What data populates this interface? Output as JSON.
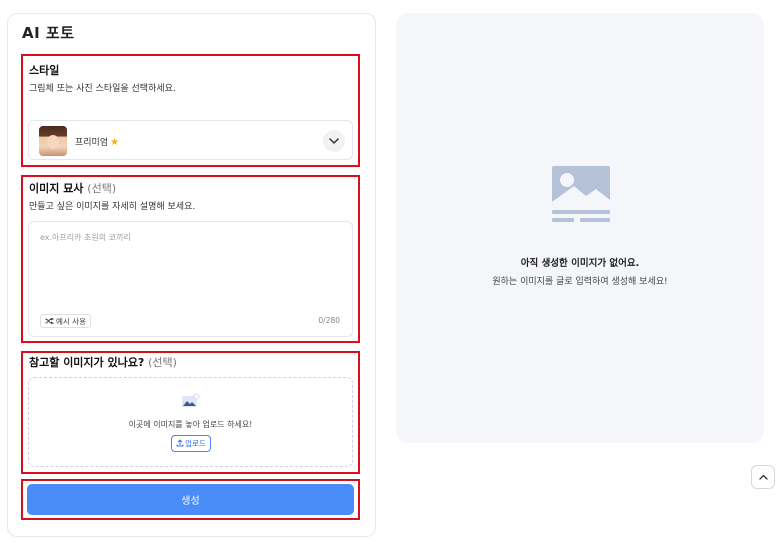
{
  "app": {
    "title": "AI 포토"
  },
  "style_section": {
    "title": "스타일",
    "description": "그림체 또는 사진 스타일을 선택하세요.",
    "selected_value": "프리미엄",
    "badge_icon": "star-icon",
    "dropdown_icon": "chevron-down-icon"
  },
  "description_section": {
    "title": "이미지 묘사",
    "optional": "(선택)",
    "description": "만들고 싶은 이미지를 자세히 설명해 보세요.",
    "placeholder": "ex.아프리카 초원의 코끼리",
    "example_button": "예시 사용",
    "example_icon": "shuffle-icon",
    "char_count": "0/280"
  },
  "reference_section": {
    "title": "참고할 이미지가 있나요?",
    "optional": "(선택)",
    "drop_text": "이곳에 이미지를 놓아 업로드 하세요!",
    "upload_button": "업로드",
    "upload_icon": "upload-icon"
  },
  "generate_button": "생성",
  "preview": {
    "empty_title": "아직 생성한 이미지가 없어요.",
    "empty_description": "원하는 이미지를 글로 입력하여 생성해 보세요!",
    "icon": "image-placeholder-icon"
  },
  "scroll_top_icon": "chevron-up-icon",
  "colors": {
    "accent": "#4a8cf7",
    "highlight_border": "#d6111b",
    "preview_bg": "#f4f6f9",
    "star": "#f5b400"
  }
}
